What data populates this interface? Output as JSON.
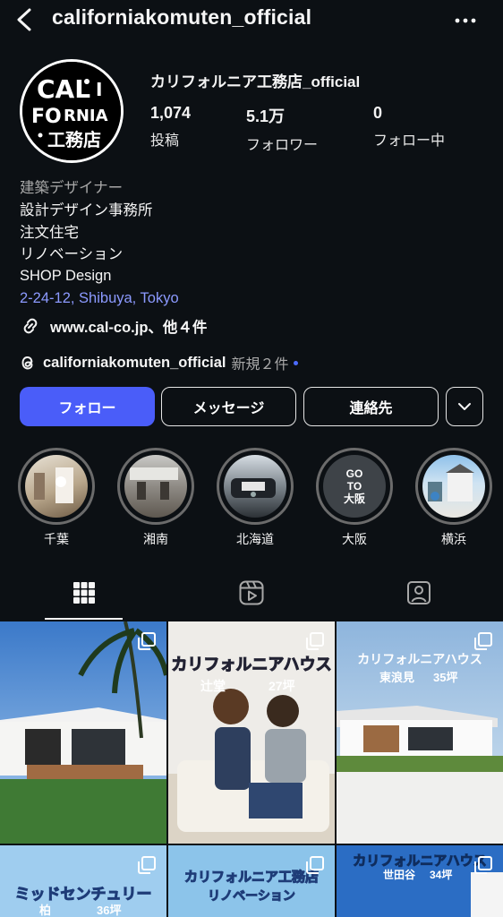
{
  "header": {
    "username": "californiakomuten_official",
    "back_icon": "chevron-left-icon",
    "more_icon": "more-horizontal-icon"
  },
  "profile": {
    "avatar_text": "CALI FORNIA 工務店",
    "display_name": "カリフォルニア工務店_official",
    "stats": [
      {
        "value": "1,074",
        "label": "投稿"
      },
      {
        "value": "5.1万",
        "label": "フォロワー"
      },
      {
        "value": "0",
        "label": "フォロー中"
      }
    ],
    "category": "建築デザイナー",
    "bio_lines": [
      "設計デザイン事務所",
      "注文住宅",
      "リノベーション",
      "SHOP Design"
    ],
    "address": "2-24-12, Shibuya, Tokyo",
    "link_text": "www.cal-co.jp、他４件",
    "threads_handle": "californiakomuten_official",
    "threads_new": "新規２件"
  },
  "actions": {
    "follow": "フォロー",
    "message": "メッセージ",
    "contact": "連絡先"
  },
  "highlights": [
    {
      "label": "千葉"
    },
    {
      "label": "湘南"
    },
    {
      "label": "北海道"
    },
    {
      "label": "大阪",
      "thumb_text": [
        "GO",
        "TO",
        "大阪"
      ]
    },
    {
      "label": "横浜"
    }
  ],
  "tabs": [
    "grid-icon",
    "reels-icon",
    "tagged-icon"
  ],
  "posts": [
    {
      "text": ""
    },
    {
      "text": "カリフォルニアハウス",
      "sub_left": "辻堂",
      "sub_right": "27坪"
    },
    {
      "text": "カリフォルニアハウス",
      "sub_left": "東浪見",
      "sub_right": "35坪"
    },
    {
      "text": "ミッドセンチュリー",
      "sub_left": "柏",
      "sub_right": "36坪"
    },
    {
      "text": "カリフォルニア工務店",
      "sub_left": "リノベーション",
      "sub_right": ""
    },
    {
      "text": "カリフォルニアハウス",
      "sub_left": "世田谷",
      "sub_right": "34坪"
    }
  ],
  "colors": {
    "background": "#0c1014",
    "primary_button": "#4a5df9",
    "address_link": "#8c9aff"
  }
}
